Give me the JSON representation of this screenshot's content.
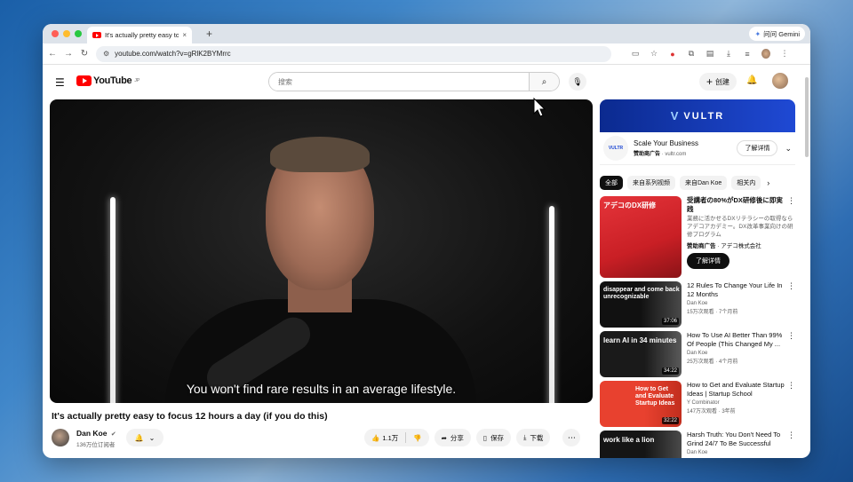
{
  "tab": {
    "title": "It's actually pretty easy to foc",
    "close": "×",
    "new": "+"
  },
  "gemini": {
    "label": "问问 Gemini"
  },
  "address": {
    "url": "youtube.com/watch?v=gRlK2BYMrrc"
  },
  "yt": {
    "logo": "YouTube",
    "logo_region": "JP",
    "search_placeholder": "搜索",
    "create_label": "创建"
  },
  "video": {
    "caption": "You won't find rare results in an average lifestyle.",
    "title": "It's actually pretty easy to focus 12 hours a day (if you do this)",
    "channel": "Dan Koe",
    "subscribers": "136万位订阅者",
    "likes": "1.1万",
    "share": "分享",
    "save": "保存",
    "download": "下载"
  },
  "ad": {
    "brand": "VULTR",
    "title": "Scale Your Business",
    "sponsor": "赞助商广告",
    "domain": "vultr.com",
    "learn_more": "了解详情"
  },
  "chips": [
    "全部",
    "来自系列视频",
    "来自Dan Koe",
    "相关内"
  ],
  "sponsored_rec": {
    "title": "受講者の80%がDX研修後に即実践",
    "desc": "業務に活かせるDXリテラシーの取得ならアデコアカデミー。DX改革事業向けの研修プログラム",
    "sponsor": "赞助商广告",
    "advertiser": "アデコ株式会社",
    "learn_more": "了解详情",
    "thumb_text": "アデコのDX研修"
  },
  "recs": [
    {
      "title": "12 Rules To Change Your Life In 12 Months",
      "channel": "Dan Koe",
      "meta": "15万次观看 · 7个月前",
      "duration": "37:06",
      "thumb_text": "disappear and come back unrecognizable"
    },
    {
      "title": "How To Use AI Better Than 99% Of People (This Changed My ...",
      "channel": "Dan Koe",
      "meta": "25万次观看 · 4个月前",
      "duration": "34:22",
      "thumb_text": "learn AI in 34 minutes"
    },
    {
      "title": "How to Get and Evaluate Startup Ideas | Startup School",
      "channel": "Y Combinator",
      "meta": "147万次观看 · 3年前",
      "duration": "32:22",
      "thumb_text": "How to Get and Evaluate Startup Ideas"
    },
    {
      "title": "Harsh Truth: You Don't Need To Grind 24/7 To Be Successful",
      "channel": "Dan Koe",
      "meta": "",
      "duration": "",
      "thumb_text": "work like a lion"
    }
  ],
  "colors": {
    "brand_red": "#ff0000",
    "vultr_blue": "#1f49d4"
  }
}
